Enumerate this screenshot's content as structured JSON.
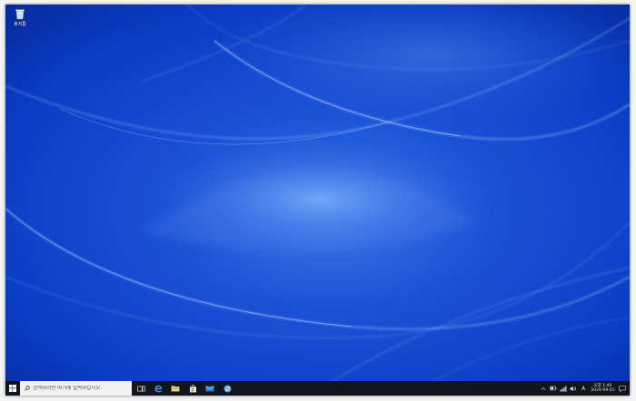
{
  "desktop": {
    "icons": [
      {
        "label": "휴지통",
        "icon": "recycle-bin-icon"
      }
    ]
  },
  "taskbar": {
    "start_icon": "windows-logo-icon",
    "search": {
      "placeholder": "검색하려면 여기에 입력하십시오.",
      "value": ""
    },
    "pinned": [
      {
        "icon": "task-view-icon"
      },
      {
        "icon": "edge-icon"
      },
      {
        "icon": "file-explorer-icon"
      },
      {
        "icon": "store-icon"
      },
      {
        "icon": "mail-icon"
      },
      {
        "icon": "app-icon"
      }
    ],
    "tray": {
      "ime": "A",
      "clock": {
        "time": "오후 1:40",
        "date": "2020-09-01"
      }
    }
  },
  "colors": {
    "wallpaper_base": "#0a3fc7",
    "wallpaper_dark": "#0627a0",
    "taskbar": "#10151e",
    "accent": "#3b8de8"
  }
}
